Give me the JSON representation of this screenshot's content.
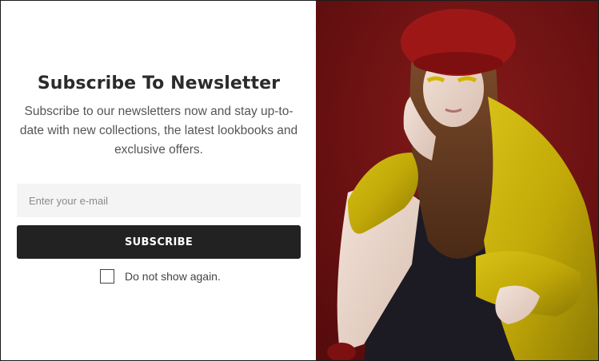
{
  "popup": {
    "title": "Subscribe To Newsletter",
    "description": "Subscribe to our newsletters now and stay up-to-date with new collections, the latest lookbooks and exclusive offers.",
    "email_placeholder": "Enter your e-mail",
    "email_value": "",
    "subscribe_label": "SUBSCRIBE",
    "dont_show_label": "Do not show again.",
    "dont_show_checked": false
  },
  "image": {
    "subject": "model-photo",
    "background_color": "#6a0f10",
    "coat_color": "#c9b10a",
    "beret_color": "#9e1717"
  },
  "colors": {
    "button_bg": "#222222",
    "input_bg": "#f4f4f4",
    "title_color": "#2b2b2b",
    "text_color": "#555555"
  }
}
